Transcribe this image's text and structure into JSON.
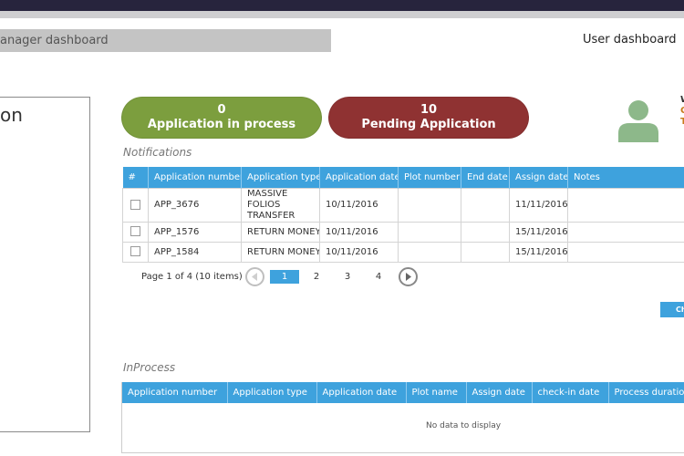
{
  "header": {
    "manager_tab": "anager dashboard",
    "user_tab": "User dashboard"
  },
  "left_panel": {
    "title": "on"
  },
  "stats": {
    "in_process": {
      "count": "0",
      "label": "Application in process",
      "color": "#7c9e3e"
    },
    "pending": {
      "count": "10",
      "label": "Pending Application",
      "color": "#8f3232"
    }
  },
  "user_side_letters": [
    "W",
    "C",
    "T"
  ],
  "notifications": {
    "title": "Notifications",
    "columns": [
      "#",
      "Application number",
      "Application type",
      "Application date",
      "Plot number",
      "End date",
      "Assign date",
      "Notes"
    ],
    "rows": [
      {
        "number": "APP_3676",
        "type": "MASSIVE FOLIOS TRANSFER",
        "date": "10/11/2016",
        "plot": "",
        "end": "",
        "assign": "11/11/2016",
        "notes": ""
      },
      {
        "number": "APP_1576",
        "type": "RETURN MONEY",
        "date": "10/11/2016",
        "plot": "",
        "end": "",
        "assign": "15/11/2016",
        "notes": ""
      },
      {
        "number": "APP_1584",
        "type": "RETURN MONEY",
        "date": "10/11/2016",
        "plot": "",
        "end": "",
        "assign": "15/11/2016",
        "notes": ""
      }
    ],
    "pager": {
      "info": "Page 1 of 4 (10 items)",
      "pages": [
        "1",
        "2",
        "3",
        "4"
      ],
      "current": "1"
    },
    "action_button": "Ch"
  },
  "inprocess": {
    "title": "InProcess",
    "columns": [
      "Application number",
      "Application type",
      "Application date",
      "Plot name",
      "Assign date",
      "check-in date",
      "Process duration"
    ],
    "empty_text": "No data to display"
  },
  "colors": {
    "accent": "#3ea2dd",
    "avatar": "#8db88a"
  }
}
